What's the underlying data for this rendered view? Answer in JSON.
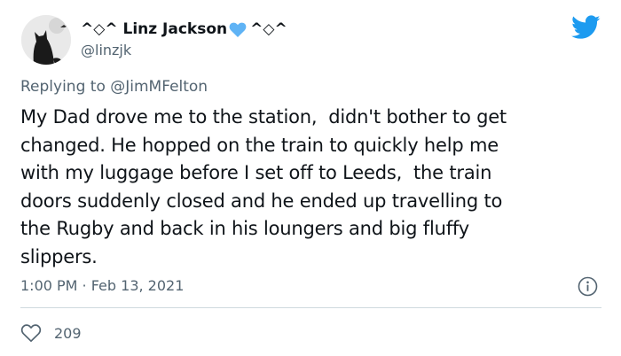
{
  "tweet": {
    "display_name": "^◇^ Linz Jackson",
    "name_suffix": "^◇^",
    "handle": "@linzjk",
    "reply_prefix": "Replying to ",
    "reply_mention": "@JimMFelton",
    "text": "My Dad drove me to the station,  didn't bother to get\nchanged. He hopped on the train to quickly help me\nwith my luggage before I set off to Leeds,  the train\ndoors suddenly closed and he ended up travelling to\nthe Rugby and back in his loungers and big fluffy\nslippers.",
    "timestamp": "1:00 PM · Feb 13, 2021",
    "like_count": "209"
  },
  "icons": {
    "avatar": "cat-silhouette-avatar",
    "name_emoji": "blue-heart-icon",
    "brand": "twitter-bird-icon",
    "info": "info-icon",
    "like": "heart-outline-icon"
  },
  "colors": {
    "brand_blue": "#1d9bf0",
    "heart_blue": "#5fb3f5",
    "secondary_text": "#536471",
    "primary_text": "#0f1419"
  }
}
